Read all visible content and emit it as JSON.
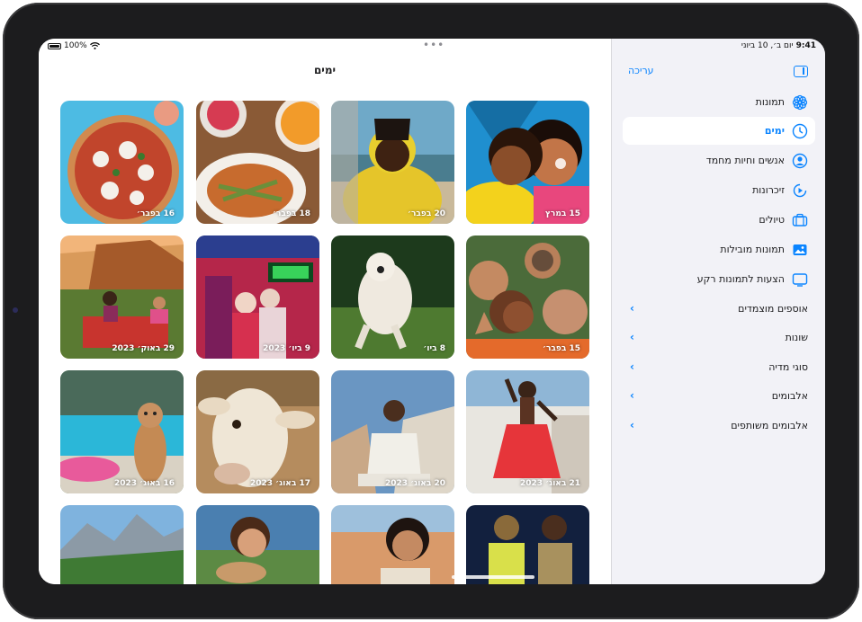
{
  "status": {
    "battery": "100%",
    "time": "9:41",
    "date": "יום ב׳, 10 ביוני"
  },
  "header": {
    "title": "ימים",
    "edit_label": "עריכה"
  },
  "sidebar": {
    "items": [
      {
        "label": "תמונות",
        "icon": "flower-icon",
        "selected": false
      },
      {
        "label": "ימים",
        "icon": "clock-icon",
        "selected": true
      },
      {
        "label": "אנשים וחיות מחמד",
        "icon": "person-circle-icon",
        "selected": false
      },
      {
        "label": "זיכרונות",
        "icon": "memories-play-icon",
        "selected": false
      },
      {
        "label": "טיולים",
        "icon": "suitcase-icon",
        "selected": false
      },
      {
        "label": "תמונות מובילות",
        "icon": "photo-icon",
        "selected": false
      },
      {
        "label": "הצעות לתמונות רקע",
        "icon": "display-icon",
        "selected": false
      }
    ],
    "groups": [
      {
        "label": "אוספים מוצמדים"
      },
      {
        "label": "שונות"
      },
      {
        "label": "סוגי מדיה"
      },
      {
        "label": "אלבומים"
      },
      {
        "label": "אלבומים משותפים"
      }
    ]
  },
  "tiles": [
    {
      "date": "15 במרץ"
    },
    {
      "date": "20 בפבר׳"
    },
    {
      "date": "18 בפבר׳"
    },
    {
      "date": "16 בפבר׳"
    },
    {
      "date": "15 בפבר׳"
    },
    {
      "date": "8 ביו׳"
    },
    {
      "date": "9 ביו׳ 2023"
    },
    {
      "date": "29 באוק׳ 2023"
    },
    {
      "date": "21 באוג׳ 2023"
    },
    {
      "date": "20 באוג׳ 2023"
    },
    {
      "date": "17 באוג׳ 2023"
    },
    {
      "date": "16 באוג׳ 2023"
    },
    {
      "date": ""
    },
    {
      "date": ""
    },
    {
      "date": ""
    },
    {
      "date": ""
    }
  ],
  "colors": {
    "accent": "#0a84ff",
    "sidebar_bg": "#f2f2f7"
  }
}
